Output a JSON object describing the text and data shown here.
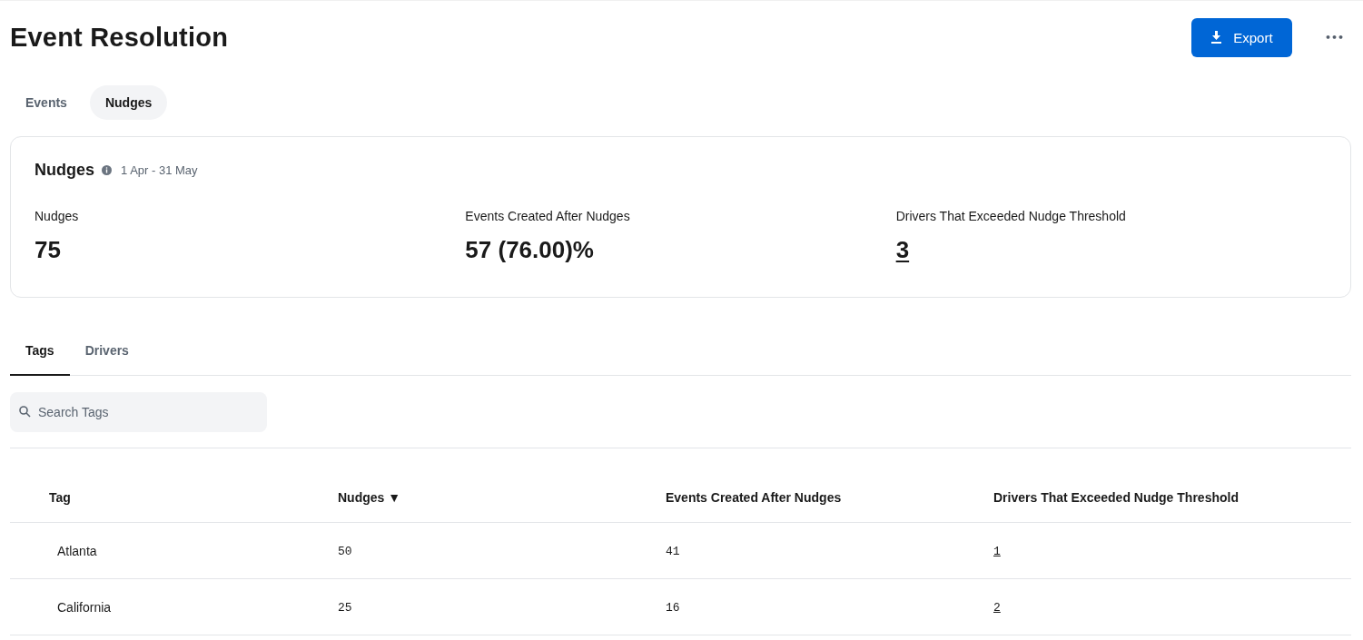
{
  "header": {
    "title": "Event Resolution",
    "export_label": "Export",
    "more_label": "•••"
  },
  "view_tabs": [
    {
      "label": "Events",
      "selected": false
    },
    {
      "label": "Nudges",
      "selected": true
    }
  ],
  "summary": {
    "title": "Nudges",
    "date_range": "1 Apr - 31 May",
    "stats": [
      {
        "label": "Nudges",
        "value": "75",
        "kind": "plain"
      },
      {
        "label": "Events Created After Nudges",
        "value": "57 (76.00)%",
        "kind": "plain"
      },
      {
        "label": "Drivers That Exceeded Nudge Threshold",
        "value": "3",
        "kind": "link"
      }
    ]
  },
  "section_tabs": [
    {
      "label": "Tags",
      "selected": true
    },
    {
      "label": "Drivers",
      "selected": false
    }
  ],
  "search": {
    "placeholder": "Search Tags"
  },
  "table": {
    "columns": [
      {
        "label": "Tag",
        "kind": "text"
      },
      {
        "label": "Nudges ▼",
        "kind": "number"
      },
      {
        "label": "Events Created After Nudges",
        "kind": "number"
      },
      {
        "label": "Drivers That Exceeded Nudge Threshold",
        "kind": "link"
      }
    ],
    "rows": [
      [
        "Atlanta",
        "50",
        "41",
        "1"
      ],
      [
        "California",
        "25",
        "16",
        "2"
      ]
    ]
  }
}
